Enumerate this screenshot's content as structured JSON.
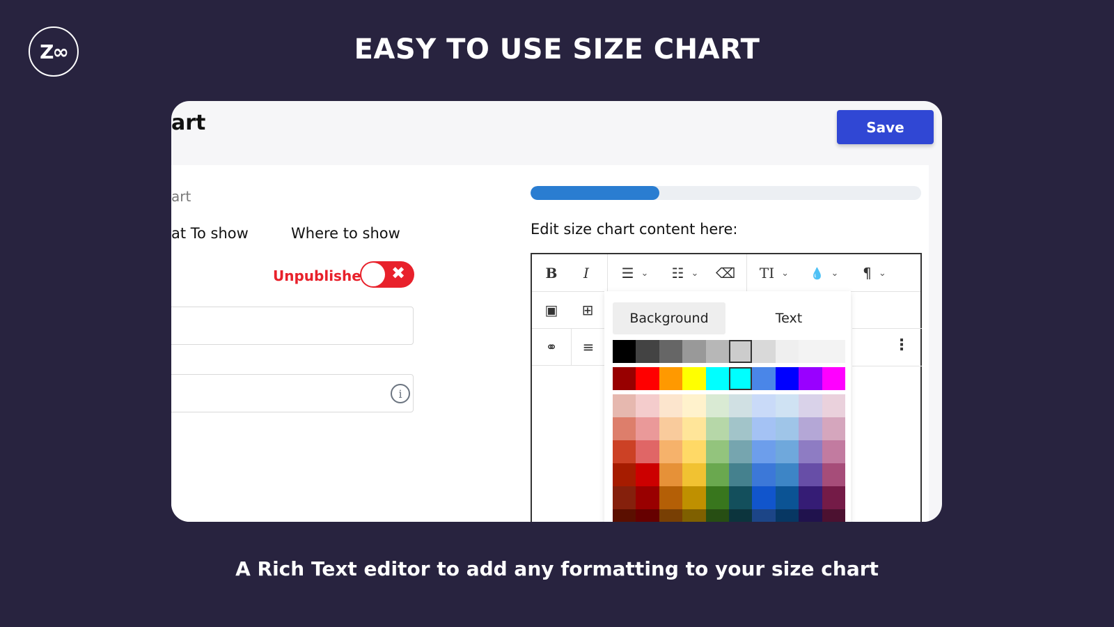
{
  "banner": {
    "logo_text": "Z∞",
    "headline": "EASY TO USE SIZE CHART",
    "caption": "A Rich Text editor to add any formatting to your size chart"
  },
  "app": {
    "page_title": "art",
    "save_label": "Save",
    "section_label": "art",
    "tabs": [
      {
        "label": "at To show"
      },
      {
        "label": "Where to show"
      }
    ],
    "publish_status": "Unpublished",
    "toggle_glyph": "✖",
    "info_glyph": "i",
    "progress_percent": 33,
    "editor_label": "Edit size chart content here:",
    "toolbar": {
      "bold": "B",
      "italic": "I",
      "bullet_list": "☰",
      "numbered_list": "☷",
      "clear_format": "⌫",
      "text_size": "TI",
      "color": "💧",
      "paragraph": "¶",
      "caret": "⌄",
      "image": "▣",
      "table": "⊞",
      "link": "⚭",
      "align": "≡",
      "more": "⋮"
    },
    "color_picker": {
      "tabs": [
        {
          "label": "Background"
        },
        {
          "label": "Text"
        }
      ],
      "selected_color": "#cccccc"
    },
    "colors": {
      "accent": "#3047d4",
      "status_red": "#e8212b",
      "progress": "#2a7dd1"
    }
  }
}
